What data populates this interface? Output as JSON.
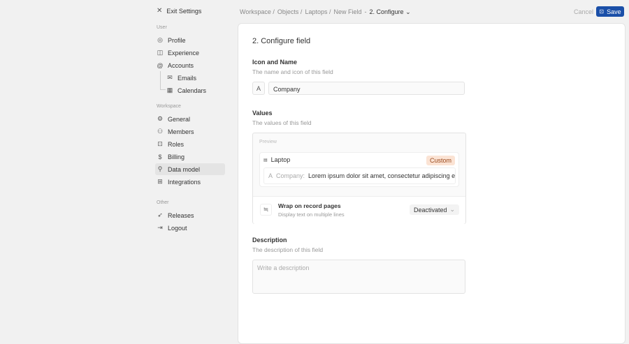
{
  "sidebar": {
    "exit": "Exit Settings",
    "user_label": "User",
    "workspace_label": "Workspace",
    "other_label": "Other",
    "user_items": [
      "Profile",
      "Experience",
      "Accounts",
      "Emails",
      "Calendars"
    ],
    "workspace_items": [
      "General",
      "Members",
      "Roles",
      "Billing",
      "Data model",
      "Integrations"
    ],
    "other_items": [
      "Releases",
      "Logout"
    ]
  },
  "breadcrumb": {
    "items": [
      "Workspace",
      "Objects",
      "Laptops",
      "New Field"
    ],
    "sep": "/",
    "dash": "-",
    "current": "2. Configure"
  },
  "header": {
    "cancel": "Cancel",
    "save": "Save"
  },
  "main": {
    "title": "2. Configure field",
    "icon_name": {
      "title": "Icon and Name",
      "subtitle": "The name and icon of this field",
      "value": "Company"
    },
    "values": {
      "title": "Values",
      "subtitle": "The values of this field",
      "preview_label": "Preview",
      "record": "Laptop",
      "badge": "Custom",
      "field_label": "Company:",
      "field_value": "Lorem ipsum dolor sit amet, consectetur adipiscing elit. ...",
      "wrap_title": "Wrap on record pages",
      "wrap_sub": "Display text on multiple lines",
      "wrap_value": "Deactivated"
    },
    "description": {
      "title": "Description",
      "subtitle": "The description of this field",
      "placeholder": "Write a description"
    }
  }
}
